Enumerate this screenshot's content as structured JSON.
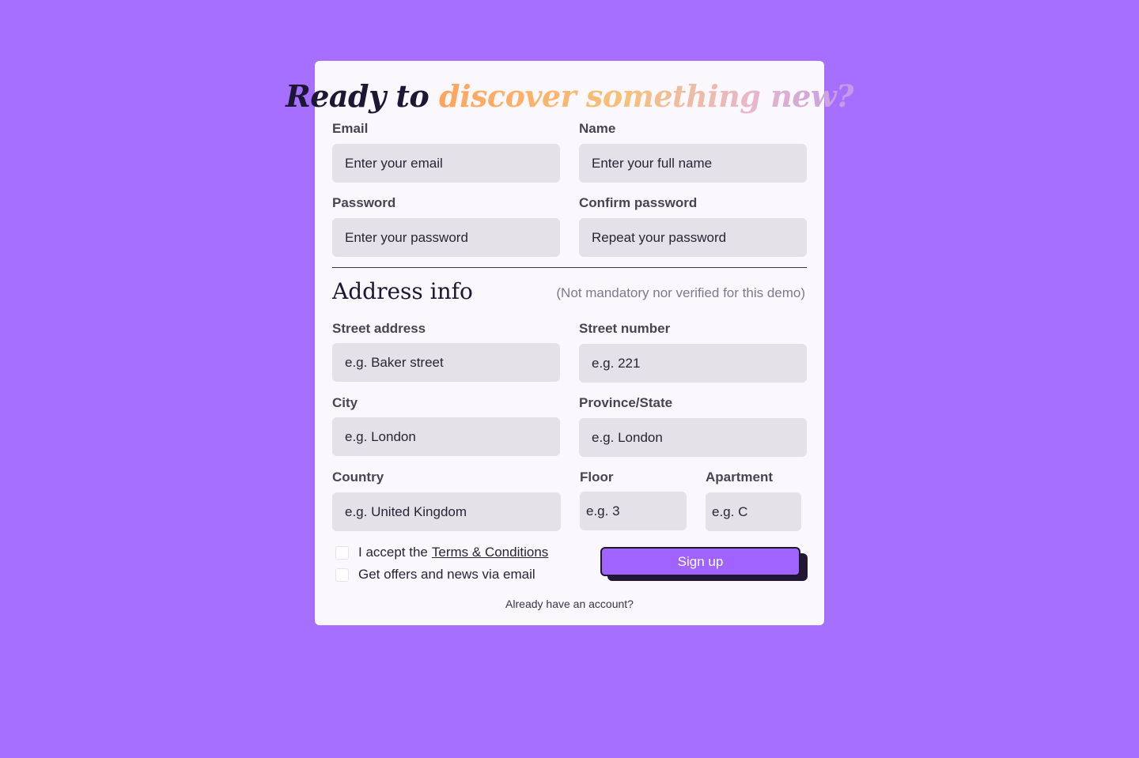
{
  "page": {
    "background": "#a66fff",
    "card_background": "#faf7fd",
    "accent": "#a063ff"
  },
  "header": {
    "title_part1": "Ready to",
    "title_part2": "discover something new?"
  },
  "account": {
    "email_label": "Email",
    "email_placeholder": "Enter your email",
    "name_label": "Name",
    "name_placeholder": "Enter your full name",
    "password_label": "Password",
    "password_placeholder": "Enter your password",
    "confirm_label": "Confirm password",
    "confirm_placeholder": "Repeat your password"
  },
  "address": {
    "title": "Address info",
    "note": "(Not mandatory nor verified for this demo)",
    "street_label": "Street address",
    "street_placeholder": "e.g. Baker street",
    "number_label": "Street number",
    "number_placeholder": "e.g. 221",
    "city_label": "City",
    "city_placeholder": "e.g. London",
    "province_label": "Province/State",
    "province_placeholder": "e.g. London",
    "country_label": "Country",
    "country_placeholder": "e.g. United Kingdom",
    "floor_label": "Floor",
    "floor_placeholder": "e.g. 3",
    "apartment_label": "Apartment",
    "apartment_placeholder": "e.g. C"
  },
  "consent": {
    "terms_prefix": "I accept the",
    "terms_link": "Terms & Conditions",
    "offers_label": "Get offers and news via email"
  },
  "actions": {
    "signup_label": "Sign up",
    "login_link": "Already have an account?"
  }
}
